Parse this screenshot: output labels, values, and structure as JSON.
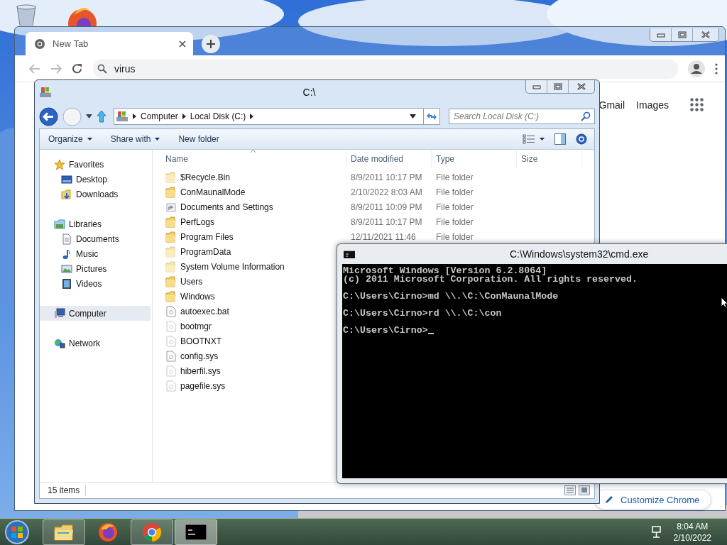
{
  "browser": {
    "tab": {
      "title": "New Tab"
    },
    "omnibox": {
      "value": "virus"
    },
    "links": [
      "Gmail",
      "Images"
    ],
    "customize_button": "Customize Chrome"
  },
  "explorer": {
    "title": "C:\\",
    "breadcrumb": [
      "Computer",
      "Local Disk (C:)"
    ],
    "search": {
      "placeholder": "Search Local Disk (C:)"
    },
    "toolbar": [
      {
        "label": "Organize",
        "dropdown": true
      },
      {
        "label": "Share with",
        "dropdown": true
      },
      {
        "label": "New folder",
        "dropdown": false
      }
    ],
    "nav": [
      {
        "label": "Favorites",
        "kind": "star",
        "selected": false,
        "children": [
          {
            "label": "Desktop",
            "kind": "desktop",
            "selected": false
          },
          {
            "label": "Downloads",
            "kind": "downloads",
            "selected": false
          }
        ]
      },
      {
        "label": "Libraries",
        "kind": "library",
        "selected": false,
        "children": [
          {
            "label": "Documents",
            "kind": "documents",
            "selected": false
          },
          {
            "label": "Music",
            "kind": "music",
            "selected": false
          },
          {
            "label": "Pictures",
            "kind": "pictures",
            "selected": false
          },
          {
            "label": "Videos",
            "kind": "videos",
            "selected": false
          }
        ]
      },
      {
        "label": "Computer",
        "kind": "computer",
        "selected": true
      },
      {
        "label": "Network",
        "kind": "network",
        "selected": false
      }
    ],
    "columns": [
      "Name",
      "Date modified",
      "Type",
      "Size"
    ],
    "rows": [
      {
        "name": "$Recycle.Bin",
        "kind": "folder",
        "hidden": true,
        "date": "8/9/2011 10:17 PM",
        "type": "File folder"
      },
      {
        "name": "ConMaunalMode",
        "kind": "folder",
        "hidden": false,
        "date": "2/10/2022 8:03 AM",
        "type": "File folder"
      },
      {
        "name": "Documents and Settings",
        "kind": "shortcut",
        "hidden": true,
        "date": "8/9/2011 10:09 PM",
        "type": "File folder"
      },
      {
        "name": "PerfLogs",
        "kind": "folder",
        "hidden": false,
        "date": "8/9/2011 10:17 PM",
        "type": "File folder"
      },
      {
        "name": "Program Files",
        "kind": "folder",
        "hidden": false,
        "date": "12/11/2021 11:46",
        "type": "File folder"
      },
      {
        "name": "ProgramData",
        "kind": "folder",
        "hidden": true
      },
      {
        "name": "System Volume Information",
        "kind": "folder",
        "hidden": true
      },
      {
        "name": "Users",
        "kind": "folder",
        "hidden": false
      },
      {
        "name": "Windows",
        "kind": "folder",
        "hidden": false
      },
      {
        "name": "autoexec.bat",
        "kind": "file",
        "hidden": false
      },
      {
        "name": "bootmgr",
        "kind": "file",
        "hidden": true
      },
      {
        "name": "BOOTNXT",
        "kind": "file",
        "hidden": true
      },
      {
        "name": "config.sys",
        "kind": "file",
        "hidden": false
      },
      {
        "name": "hiberfil.sys",
        "kind": "file",
        "hidden": true
      },
      {
        "name": "pagefile.sys",
        "kind": "file",
        "hidden": true
      }
    ],
    "status": "15 items"
  },
  "console": {
    "title": "C:\\Windows\\system32\\cmd.exe",
    "paragraphs": [
      [
        "Microsoft Windows [Version 6.2.8064]",
        "(c) 2011 Microsoft Corporation. All rights reserved."
      ],
      [
        "C:\\Users\\Cirno>md \\\\.\\C:\\ConMaunalMode"
      ],
      [
        "C:\\Users\\Cirno>rd \\\\.\\C:\\con"
      ],
      [
        "C:\\Users\\Cirno>"
      ]
    ],
    "cursor": true
  },
  "taskbar": {
    "buttons": [
      {
        "kind": "explorer",
        "running": true,
        "selected": false
      },
      {
        "kind": "firefox",
        "running": false,
        "selected": false
      },
      {
        "kind": "chrome",
        "running": true,
        "selected": false
      },
      {
        "kind": "console",
        "running": true,
        "selected": true
      }
    ],
    "clock": {
      "time": "8:04 AM",
      "date": "2/10/2022"
    }
  }
}
